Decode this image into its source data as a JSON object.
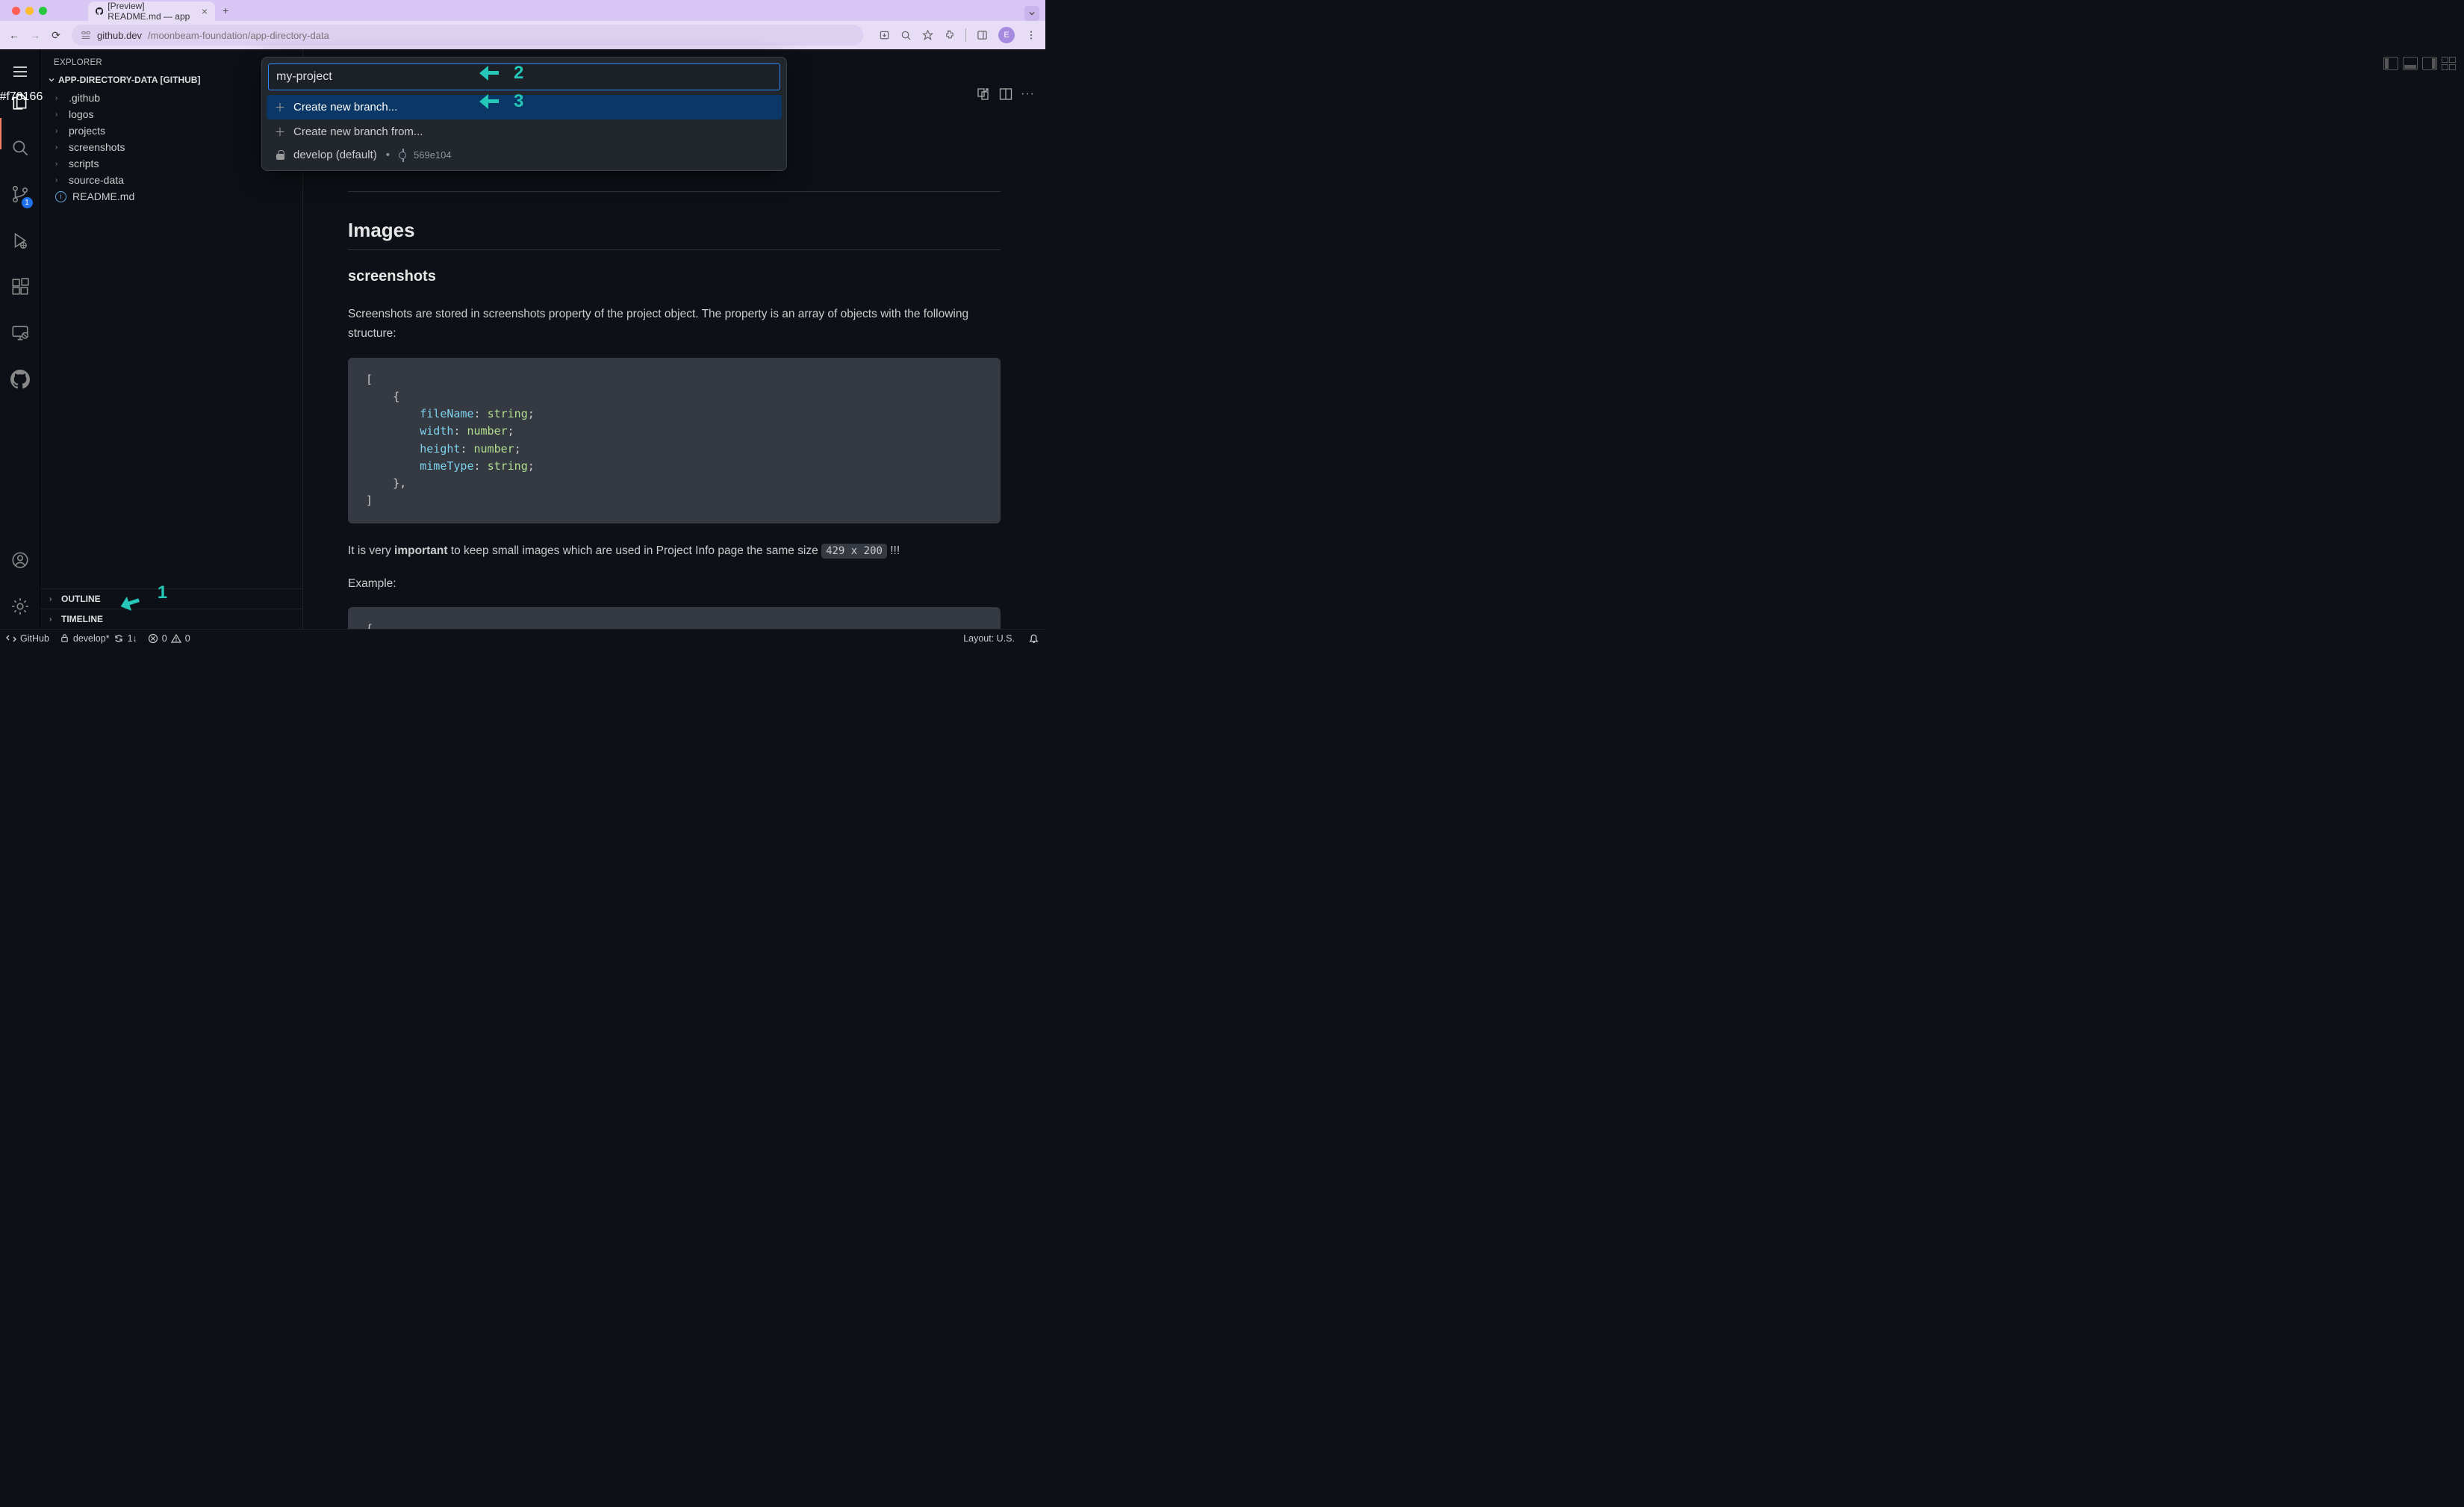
{
  "browser": {
    "tab_title": "[Preview] README.md — app",
    "url_host": "github.dev",
    "url_path": "/moonbeam-foundation/app-directory-data",
    "avatar_letter": "E"
  },
  "activity": {
    "scm_badge": "1"
  },
  "sidebar": {
    "title": "EXPLORER",
    "section": "APP-DIRECTORY-DATA [GITHUB]",
    "tree": [
      ".github",
      "logos",
      "projects",
      "screenshots",
      "scripts",
      "source-data"
    ],
    "readme": "README.md",
    "outline": "OUTLINE",
    "timeline": "TIMELINE"
  },
  "palette": {
    "input_value": "my-project",
    "items": [
      {
        "icon": "plus",
        "label": "Create new branch..."
      },
      {
        "icon": "plus",
        "label": "Create new branch from..."
      },
      {
        "icon": "lock",
        "label": "develop (default)",
        "commit": "569e104"
      }
    ]
  },
  "annotations": {
    "n1": "1",
    "n2": "2",
    "n3": "3"
  },
  "document": {
    "h2_images": "Images",
    "h3_screenshots": "screenshots",
    "p_intro": "Screenshots are stored in screenshots property of the project object. The property is an array of objects with the following structure:",
    "p_important_prefix": "It is very ",
    "p_important_bold": "important",
    "p_important_suffix": " to keep small images which are used in Project Info page the same size ",
    "p_important_code": "429 x 200",
    "p_important_tail": " !!!",
    "p_example": "Example:"
  },
  "status": {
    "remote": "GitHub",
    "branch": "develop*",
    "sync_down": "1↓",
    "errors": "0",
    "warnings": "0",
    "layout": "Layout: U.S."
  }
}
